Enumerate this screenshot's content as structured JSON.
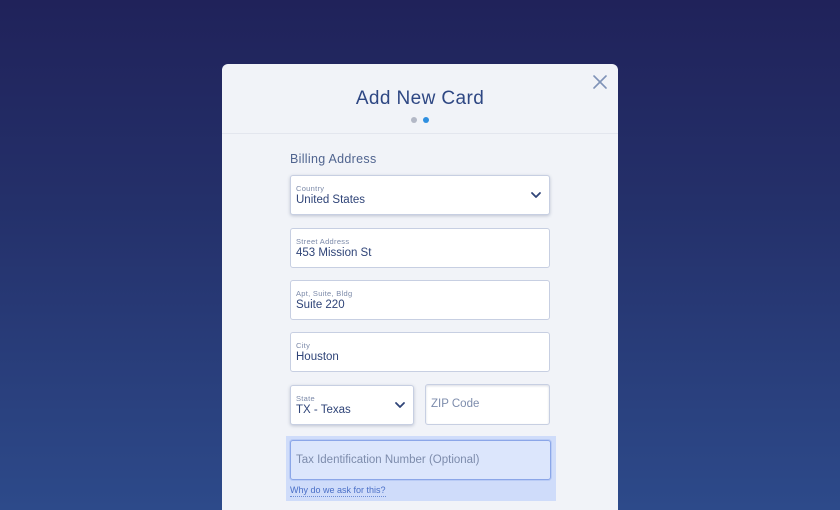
{
  "modal": {
    "title": "Add New Card",
    "steps_total": 2,
    "active_step": 2
  },
  "billing": {
    "section_title": "Billing Address",
    "country": {
      "label": "Country",
      "value": "United States"
    },
    "street": {
      "label": "Street Address",
      "value": "453 Mission St"
    },
    "apt": {
      "label": "Apt, Suite, Bldg",
      "value": "Suite 220"
    },
    "city": {
      "label": "City",
      "value": "Houston"
    },
    "state": {
      "label": "State",
      "value": "TX - Texas"
    },
    "zip": {
      "placeholder": "ZIP Code",
      "value": ""
    },
    "tax": {
      "placeholder": "Tax Identification Number (Optional)",
      "value": ""
    },
    "why_link": "Why do we ask for this?"
  },
  "icons": {
    "close": "close-icon",
    "country_dropdown": "chevron-down-icon",
    "state_dropdown": "chevron-down-icon"
  },
  "colors": {
    "background_top": "#20225a",
    "background_bottom": "#2d4a8a",
    "modal_bg": "#f1f3f8",
    "title": "#2e4783",
    "active_step": "#2f8fe0",
    "inactive_step": "#b3b8c6",
    "link": "#4a6fc7",
    "highlight": "#cfdcfa"
  }
}
